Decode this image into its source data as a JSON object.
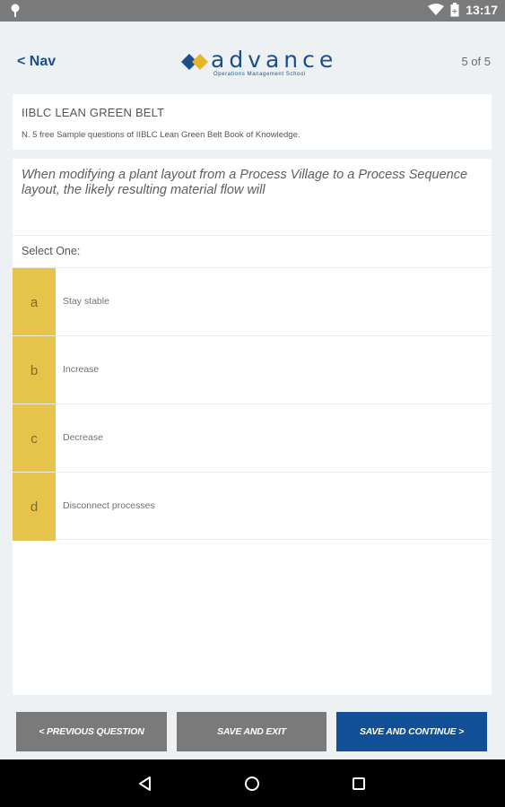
{
  "status_bar": {
    "time": "13:17",
    "icons": [
      "pin-icon",
      "wifi-icon",
      "battery-icon"
    ]
  },
  "header": {
    "back_label": "< Nav",
    "logo_word": "advance",
    "logo_sub": "Operations Management School",
    "page_indicator": "5 of 5"
  },
  "course": {
    "title": "IIBLC LEAN GREEN BELT",
    "subtitle": "N. 5 free Sample questions of IIBLC Lean Green Belt Book of Knowledge."
  },
  "question": {
    "text": "When modifying a plant layout from a Process Village to a Process Sequence layout, the likely resulting material flow will",
    "select_prompt": "Select One:",
    "options": [
      {
        "letter": "a",
        "text": "Stay stable"
      },
      {
        "letter": "b",
        "text": "Increase"
      },
      {
        "letter": "c",
        "text": "Decrease"
      },
      {
        "letter": "d",
        "text": "Disconnect processes"
      }
    ]
  },
  "buttons": {
    "previous": "< PREVIOUS QUESTION",
    "save_exit": "SAVE AND EXIT",
    "save_continue": "SAVE AND CONTINUE >"
  },
  "colors": {
    "accent": "#e6c34a",
    "brand": "#1a4f8c",
    "primary_button": "#114f96",
    "secondary_button": "#7a7a7a"
  }
}
